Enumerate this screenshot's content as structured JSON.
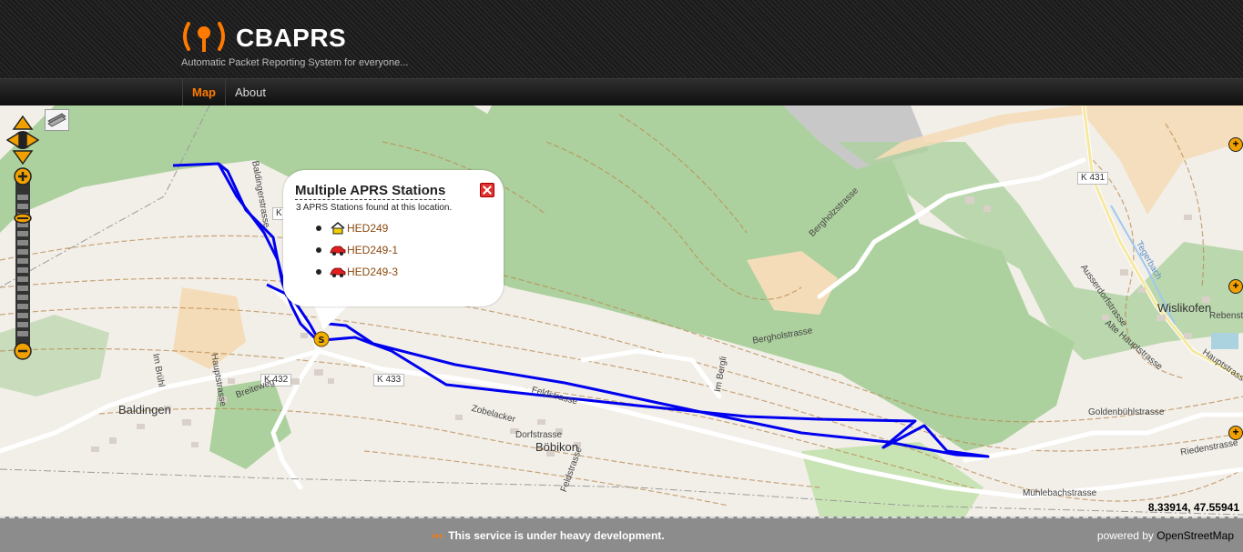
{
  "header": {
    "brand": "CBAPRS",
    "tagline": "Automatic Packet Reporting System for everyone..."
  },
  "nav": {
    "map": "Map",
    "about": "About"
  },
  "map": {
    "towns": [
      "Baldingen",
      "Böbikon",
      "Wislikofen"
    ],
    "roads": [
      "K 432",
      "K 433",
      "K 431",
      "K"
    ],
    "streets": [
      "Baldingerstrasse",
      "Hauptstrasse",
      "Breiteweg",
      "Im Brühl",
      "Bergholstrasse",
      "Bergholzstrasse",
      "Im Bergli",
      "Feldstrasse",
      "Zobelacker",
      "Dorfstrasse",
      "Feldstrasse",
      "Goldenbühlstrasse",
      "Riedenstrasse",
      "Mühlebachstrasse",
      "Ausserdorfstrasse",
      "Alte Hauptstrasse",
      "Rebenstrasse",
      "Hauptstrasse",
      "Tegerbach"
    ],
    "coordinates": "8.33914, 47.55941",
    "zoom_in": "+",
    "zoom_out": "−"
  },
  "popup": {
    "title": "Multiple APRS Stations",
    "subtitle": "3 APRS Stations found at this location.",
    "stations": [
      {
        "label": "HED249",
        "icon": "house-icon"
      },
      {
        "label": "HED249-1",
        "icon": "car-icon"
      },
      {
        "label": "HED249-3",
        "icon": "car-icon"
      }
    ]
  },
  "footer": {
    "message": "This service is under heavy development.",
    "powered_by": "powered by",
    "osm": "OpenStreetMap"
  },
  "colors": {
    "accent": "#ff7a00",
    "track": "#0000ee",
    "forest": "#add19e"
  }
}
